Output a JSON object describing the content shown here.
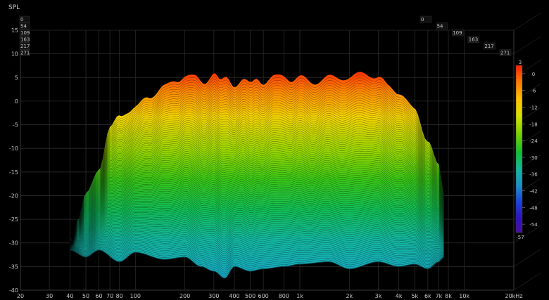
{
  "chart_data": {
    "type": "area",
    "title": "",
    "ylabel": "SPL",
    "xlabel": "",
    "x_scale": "log",
    "xlim": [
      20,
      20000
    ],
    "ylim": [
      -40,
      15
    ],
    "y_ticks": [
      15,
      10,
      5,
      0,
      -5,
      -10,
      -15,
      -20,
      -25,
      -30,
      -35,
      -40
    ],
    "x_ticks": [
      {
        "value": 20,
        "label": "20"
      },
      {
        "value": 30,
        "label": "30"
      },
      {
        "value": 40,
        "label": "40"
      },
      {
        "value": 50,
        "label": "50"
      },
      {
        "value": 60,
        "label": "60"
      },
      {
        "value": 70,
        "label": "70"
      },
      {
        "value": 80,
        "label": "80"
      },
      {
        "value": 100,
        "label": "100"
      },
      {
        "value": 200,
        "label": "200"
      },
      {
        "value": 300,
        "label": "300"
      },
      {
        "value": 400,
        "label": "400"
      },
      {
        "value": 500,
        "label": "500"
      },
      {
        "value": 600,
        "label": "600"
      },
      {
        "value": 800,
        "label": "800"
      },
      {
        "value": 1000,
        "label": "1k"
      },
      {
        "value": 2000,
        "label": "2k"
      },
      {
        "value": 3000,
        "label": "3k"
      },
      {
        "value": 4000,
        "label": "4k"
      },
      {
        "value": 5000,
        "label": "5k"
      },
      {
        "value": 6000,
        "label": "6k"
      },
      {
        "value": 7000,
        "label": "7k"
      },
      {
        "value": 8000,
        "label": "8k"
      },
      {
        "value": 10000,
        "label": "10k"
      },
      {
        "value": 20000,
        "label": "20kHz"
      }
    ],
    "z_ticks": [
      "0",
      "54",
      "109",
      "163",
      "217",
      "271"
    ],
    "colorbar": {
      "ticks": [
        "3",
        "0",
        "-6",
        "-12",
        "-18",
        "-24",
        "-30",
        "-36",
        "-42",
        "-48",
        "-54",
        "-57"
      ],
      "range": [
        -57,
        3
      ]
    },
    "grid": true,
    "front_response": {
      "freq": [
        40,
        45,
        50,
        60,
        70,
        80,
        90,
        100,
        120,
        150,
        180,
        200,
        230,
        260,
        300,
        330,
        360,
        400,
        450,
        500,
        550,
        600,
        700,
        800,
        900,
        1000,
        1200,
        1500,
        2000,
        2500,
        3000,
        3500,
        4000,
        5000,
        6000,
        7000,
        7500
      ],
      "spl": [
        -29,
        -25,
        -20,
        -14,
        -6,
        -3,
        -2,
        -1.5,
        1,
        3,
        4.5,
        5.5,
        5,
        4,
        6,
        4,
        5,
        3.5,
        4.5,
        3.5,
        5,
        4,
        5,
        5.5,
        4.5,
        5,
        4,
        5,
        5,
        6,
        5,
        3,
        2,
        -2,
        -8,
        -14,
        -20
      ]
    },
    "back_response": {
      "freq": [
        40,
        50,
        60,
        80,
        100,
        150,
        200,
        250,
        300,
        350,
        400,
        500,
        600,
        800,
        1000,
        1500,
        2000,
        3000,
        4000,
        5000,
        6000,
        7000,
        7500
      ],
      "spl": [
        -31.5,
        -33,
        -31.5,
        -34,
        -32,
        -33.5,
        -33,
        -35,
        -36,
        -37.5,
        -35,
        -36,
        -35.5,
        -35,
        -34.5,
        -34,
        -35.5,
        -34,
        -35,
        -34.5,
        -35.5,
        -34,
        -33
      ]
    },
    "slice_count": 90
  }
}
